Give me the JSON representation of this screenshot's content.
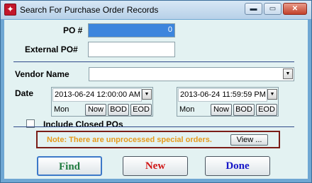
{
  "window": {
    "title": "Search For Purchase Order Records",
    "minimize_symbol": "▬",
    "maximize_symbol": "▭",
    "close_symbol": "✕",
    "app_icon": "star-app-icon"
  },
  "form": {
    "po_label": "PO #",
    "po_value": "0",
    "external_po_label": "External PO#",
    "external_po_value": "",
    "vendor_label": "Vendor Name",
    "vendor_value": "",
    "date_label": "Date",
    "date_from": {
      "value": "2013-06-24 12:00:00 AM",
      "day": "Mon",
      "now": "Now",
      "bod": "BOD",
      "eod": "EOD"
    },
    "date_to": {
      "value": "2013-06-24 11:59:59 PM",
      "day": "Mon",
      "now": "Now",
      "bod": "BOD",
      "eod": "EOD"
    },
    "include_closed_label": "Include Closed POs",
    "include_closed_checked": false
  },
  "note": {
    "text": "Note: There are unprocessed special orders.",
    "view_label": "View ...",
    "color": "#e69a1a"
  },
  "buttons": {
    "find": "Find",
    "new": "New",
    "done": "Done"
  },
  "dropdown_arrow": "▼"
}
